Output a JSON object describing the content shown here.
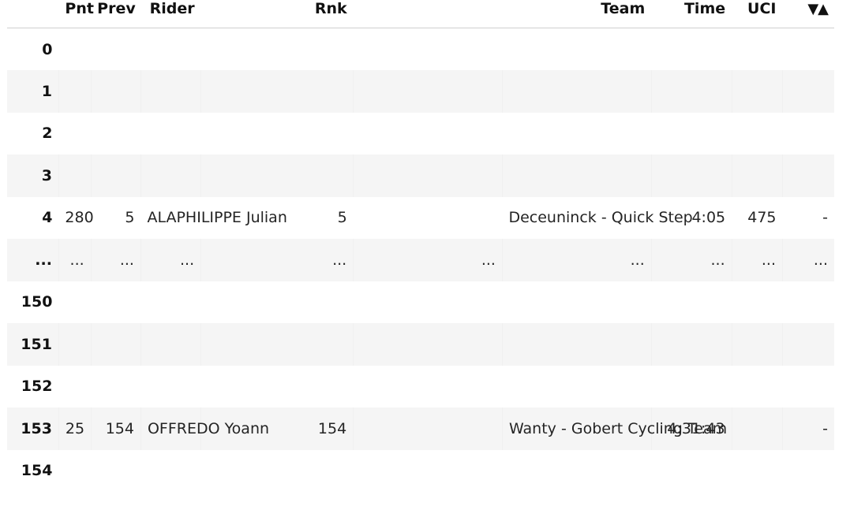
{
  "table": {
    "columns": [
      {
        "key": "index",
        "label": "",
        "align": "right"
      },
      {
        "key": "pnt",
        "label": "Pnt",
        "align": "right"
      },
      {
        "key": "prev",
        "label": "Prev",
        "align": "right"
      },
      {
        "key": "rider",
        "label": "Rider",
        "align": "right"
      },
      {
        "key": "rnk",
        "label": "Rnk",
        "align": "right"
      },
      {
        "key": "gap",
        "label": "",
        "align": "right"
      },
      {
        "key": "team",
        "label": "Team",
        "align": "right"
      },
      {
        "key": "time",
        "label": "Time",
        "align": "right"
      },
      {
        "key": "uci",
        "label": "UCI",
        "align": "right"
      },
      {
        "key": "sort",
        "label": "▼▲",
        "align": "right"
      }
    ],
    "rows": [
      {
        "index": "0",
        "pnt": "",
        "prev": "",
        "rider": "",
        "rnk": "",
        "gap": "",
        "team": "",
        "time": "",
        "uci": "",
        "sort": ""
      },
      {
        "index": "1",
        "pnt": "",
        "prev": "",
        "rider": "",
        "rnk": "",
        "gap": "",
        "team": "",
        "time": "",
        "uci": "",
        "sort": ""
      },
      {
        "index": "2",
        "pnt": "",
        "prev": "",
        "rider": "",
        "rnk": "",
        "gap": "",
        "team": "",
        "time": "",
        "uci": "",
        "sort": ""
      },
      {
        "index": "3",
        "pnt": "",
        "prev": "",
        "rider": "",
        "rnk": "",
        "gap": "",
        "team": "",
        "time": "",
        "uci": "",
        "sort": ""
      },
      {
        "index": "4",
        "pnt": "280",
        "prev": "5",
        "rider": "ALAPHILIPPE Julian",
        "rnk": "5",
        "gap": "",
        "team": "Deceuninck - Quick Step",
        "time": "4:05",
        "uci": "475",
        "sort": "-"
      },
      {
        "index": "...",
        "pnt": "...",
        "prev": "...",
        "rider": "...",
        "rnk": "...",
        "gap": "...",
        "team": "...",
        "time": "...",
        "uci": "...",
        "sort": "..."
      },
      {
        "index": "150",
        "pnt": "",
        "prev": "",
        "rider": "",
        "rnk": "",
        "gap": "",
        "team": "",
        "time": "",
        "uci": "",
        "sort": ""
      },
      {
        "index": "151",
        "pnt": "",
        "prev": "",
        "rider": "",
        "rnk": "",
        "gap": "",
        "team": "",
        "time": "",
        "uci": "",
        "sort": ""
      },
      {
        "index": "152",
        "pnt": "",
        "prev": "",
        "rider": "",
        "rnk": "",
        "gap": "",
        "team": "",
        "time": "",
        "uci": "",
        "sort": ""
      },
      {
        "index": "153",
        "pnt": "25",
        "prev": "154",
        "rider": "OFFREDO Yoann",
        "rnk": "154",
        "gap": "",
        "team": "Wanty - Gobert Cycling Team",
        "time": "4:31:43",
        "uci": "",
        "sort": "-"
      },
      {
        "index": "154",
        "pnt": "",
        "prev": "",
        "rider": "",
        "rnk": "",
        "gap": "",
        "team": "",
        "time": "",
        "uci": "",
        "sort": ""
      }
    ],
    "styles": {
      "stripe_color": "#f5f5f5",
      "base_color": "#ffffff",
      "header_rule_color": "#cfcfcf",
      "text_color": "#242424",
      "index_text_color": "#111111"
    }
  }
}
